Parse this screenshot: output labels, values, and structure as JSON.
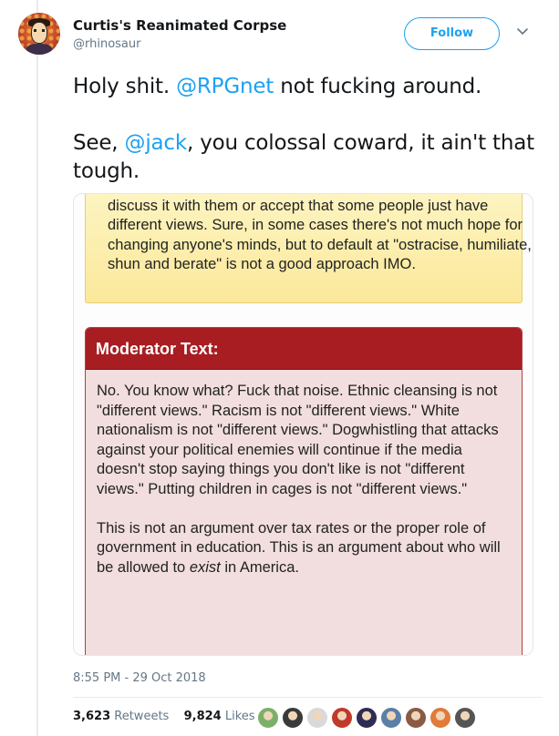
{
  "user": {
    "display_name": "Curtis's Reanimated Corpse",
    "handle": "@rhinosaur"
  },
  "actions": {
    "follow_label": "Follow"
  },
  "tweet": {
    "line1_pre": "Holy shit. ",
    "line1_mention": "@RPGnet",
    "line1_post": " not fucking around.",
    "line2_pre": "See, ",
    "line2_mention": "@jack",
    "line2_post": ", you colossal coward, it ain't that tough."
  },
  "media": {
    "quote_text": "people whose values are antithetical to their own rather than discuss it with them or accept that some people just have different views. Sure, in some cases there's not much hope for changing anyone's minds, but to default at \"ostracise, humiliate, shun and berate\" is not a good approach IMO.",
    "moderator_title": "Moderator Text:",
    "moderator_para1": "No. You know what? Fuck that noise. Ethnic cleansing is not \"different views.\" Racism is not \"different views.\" White nationalism is not \"different views.\" Dogwhistling that attacks against your political enemies will continue if the media doesn't stop saying things you don't like is not \"different views.\" Putting children in cages is not \"different views.\"",
    "moderator_para2_pre": "This is not an argument over tax rates or the proper role of government in education. This is an argument about who will be allowed to ",
    "moderator_para2_em": "exist",
    "moderator_para2_post": " in America."
  },
  "meta": {
    "timestamp": "8:55 PM - 29 Oct 2018",
    "retweets_count": "3,623",
    "retweets_label": "Retweets",
    "likes_count": "9,824",
    "likes_label": "Likes"
  },
  "colors": {
    "accent": "#1da1f2",
    "moderator_header": "#a81d22",
    "moderator_body": "#f2dede",
    "quote_bg": "#fbe89a"
  },
  "likers": [
    {
      "color": "#7cb06a"
    },
    {
      "color": "#3a3a3a"
    },
    {
      "color": "#d9d9d9"
    },
    {
      "color": "#c0392b"
    },
    {
      "color": "#2c2c54"
    },
    {
      "color": "#5b7fa6"
    },
    {
      "color": "#8a5a44"
    },
    {
      "color": "#e07b39"
    },
    {
      "color": "#555555"
    }
  ]
}
